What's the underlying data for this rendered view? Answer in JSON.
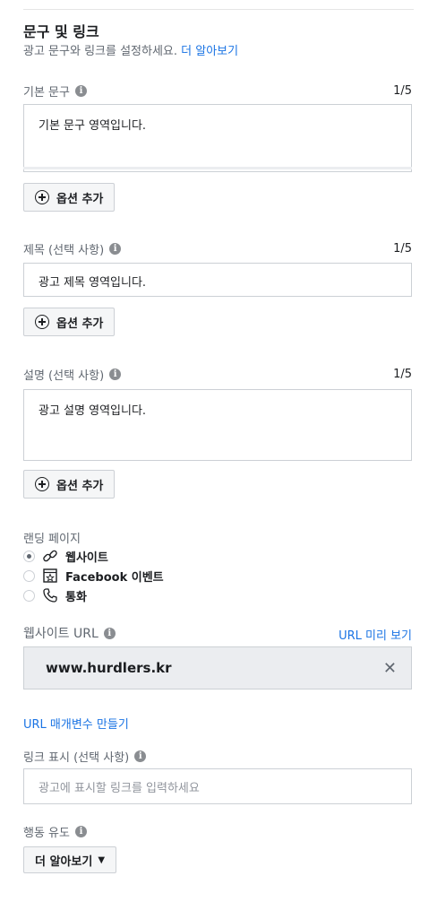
{
  "section": {
    "title": "문구 및 링크",
    "subtitle": "광고 문구와 링크를 설정하세요.",
    "learn_more": "더 알아보기"
  },
  "primary_text": {
    "label": "기본 문구",
    "counter": "1/5",
    "value": "기본 문구 영역입니다.",
    "add_option": "옵션 추가"
  },
  "headline": {
    "label": "제목 (선택 사항)",
    "counter": "1/5",
    "value": "광고 제목 영역입니다.",
    "add_option": "옵션 추가"
  },
  "description": {
    "label": "설명 (선택 사항)",
    "counter": "1/5",
    "value": "광고 설명 영역입니다.",
    "add_option": "옵션 추가"
  },
  "landing": {
    "label": "랜딩 페이지",
    "options": [
      {
        "label": "웹사이트",
        "icon": "link-icon",
        "selected": true
      },
      {
        "label": "Facebook 이벤트",
        "icon": "event-icon",
        "selected": false
      },
      {
        "label": "통화",
        "icon": "phone-icon",
        "selected": false
      }
    ]
  },
  "website_url": {
    "label": "웹사이트 URL",
    "preview_link": "URL 미리 보기",
    "value": "www.hurdlers.kr"
  },
  "url_params_link": "URL 매개변수 만들기",
  "display_link": {
    "label": "링크 표시 (선택 사항)",
    "placeholder": "광고에 표시할 링크를 입력하세요"
  },
  "cta": {
    "label": "행동 유도",
    "selected": "더 알아보기"
  },
  "colors": {
    "link_blue": "#1b74e4",
    "muted_text": "#606770",
    "border": "#ccd0d5"
  }
}
